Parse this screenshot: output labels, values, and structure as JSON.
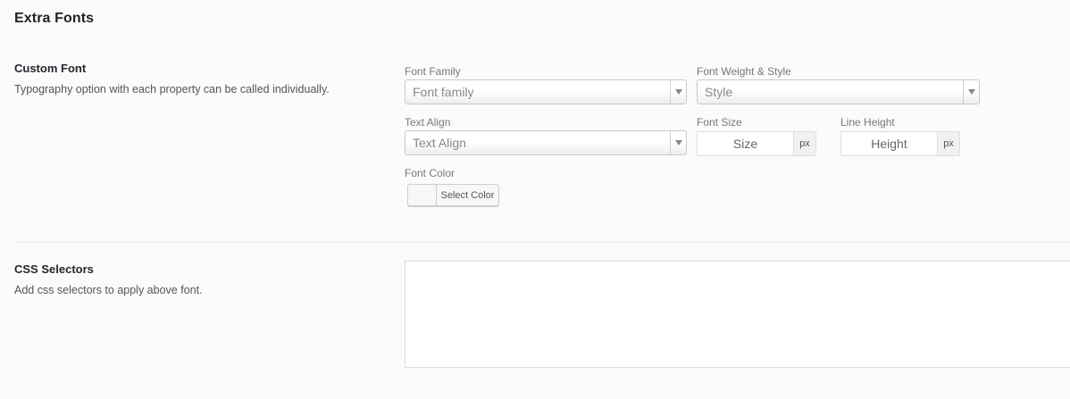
{
  "section": {
    "title": "Extra Fonts"
  },
  "custom_font": {
    "title": "Custom Font",
    "description": "Typography option with each property can be called individually.",
    "font_family": {
      "label": "Font Family",
      "value": "Font family"
    },
    "font_weight": {
      "label": "Font Weight & Style",
      "value": "Style"
    },
    "text_align": {
      "label": "Text Align",
      "value": "Text Align"
    },
    "font_size": {
      "label": "Font Size",
      "placeholder": "Size",
      "unit": "px"
    },
    "line_height": {
      "label": "Line Height",
      "placeholder": "Height",
      "unit": "px"
    },
    "font_color": {
      "label": "Font Color",
      "button_label": "Select Color"
    }
  },
  "css_selectors": {
    "title": "CSS Selectors",
    "description": "Add css selectors to apply above font.",
    "value": ""
  },
  "colors": {
    "background": "#fbfbfb",
    "border": "#dddddd",
    "text": "#333333"
  }
}
